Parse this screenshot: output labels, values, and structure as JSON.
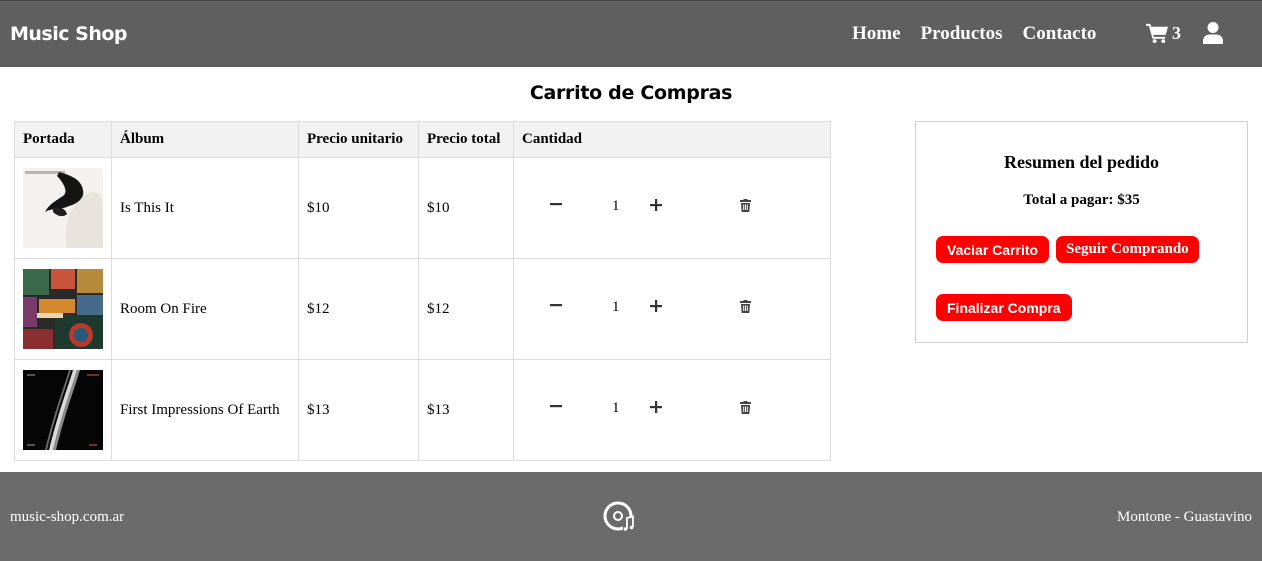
{
  "navbar": {
    "brand": "Music Shop",
    "links": [
      "Home",
      "Productos",
      "Contacto"
    ],
    "cart_count": "3",
    "cart_icon": "shopping-cart-icon",
    "user_icon": "user-icon"
  },
  "page": {
    "title": "Carrito de Compras"
  },
  "table": {
    "headers": [
      "Portada",
      "Álbum",
      "Precio unitario",
      "Precio total",
      "Cantidad"
    ],
    "rows": [
      {
        "album": "Is This It",
        "unit_price": "$10",
        "total_price": "$10",
        "quantity": "1",
        "cover_icon": "album-cover-is-this-it"
      },
      {
        "album": "Room On Fire",
        "unit_price": "$12",
        "total_price": "$12",
        "quantity": "1",
        "cover_icon": "album-cover-room-on-fire"
      },
      {
        "album": "First Impressions Of Earth",
        "unit_price": "$13",
        "total_price": "$13",
        "quantity": "1",
        "cover_icon": "album-cover-first-impressions"
      }
    ]
  },
  "summary": {
    "title": "Resumen del pedido",
    "total": "Total a pagar: $35",
    "buttons": {
      "empty": "Vaciar Carrito",
      "continue": "Seguir Comprando",
      "checkout": "Finalizar Compra"
    }
  },
  "footer": {
    "left": "music-shop.com.ar",
    "right": "Montone - Guastavino",
    "logo_icon": "vinyl-music-icon"
  },
  "colors": {
    "navbar": "#5f5f5f",
    "footer": "#6b6b6b",
    "button": "#ff0000",
    "table_header": "#f2f2f2"
  }
}
